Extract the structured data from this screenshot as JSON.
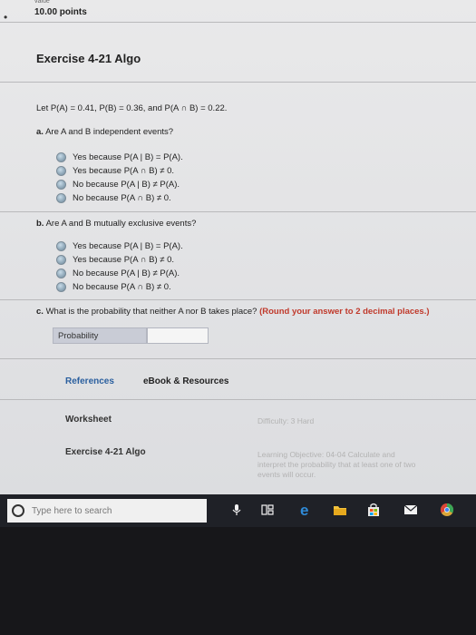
{
  "header": {
    "top_label": "value",
    "points": "10.00 points"
  },
  "exercise": {
    "title": "Exercise 4-21 Algo",
    "premise": "Let P(A) = 0.41, P(B) = 0.36, and P(A ∩ B) = 0.22."
  },
  "part_a": {
    "question": "Are A and B independent events?",
    "letter": "a.",
    "options": [
      "Yes because P(A | B) = P(A).",
      "Yes because P(A ∩ B) ≠ 0.",
      "No because P(A | B) ≠ P(A).",
      "No because P(A ∩ B) ≠ 0."
    ]
  },
  "part_b": {
    "letter": "b.",
    "question": "Are A and B mutually exclusive events?",
    "options": [
      "Yes because P(A | B) = P(A).",
      "Yes because P(A ∩ B) ≠ 0.",
      "No because P(A | B) ≠ P(A).",
      "No because P(A ∩ B) ≠ 0."
    ]
  },
  "part_c": {
    "letter": "c.",
    "question": "What is the probability that neither A nor B takes place?",
    "instruction": "(Round your answer to 2 decimal places.)",
    "field_label": "Probability",
    "field_value": ""
  },
  "links": {
    "references": "References",
    "ebook": "eBook & Resources"
  },
  "meta": {
    "worksheet": "Worksheet",
    "difficulty": "Difficulty: 3 Hard",
    "exercise_ref": "Exercise 4-21 Algo",
    "learning_objective_1": "Learning Objective: 04-04 Calculate and",
    "learning_objective_2": "interpret the probability that at least one of two",
    "learning_objective_3": "events will occur."
  },
  "taskbar": {
    "search_placeholder": "Type here to search",
    "icons": [
      "microphone-icon",
      "task-view-icon",
      "edge-icon",
      "file-explorer-icon",
      "store-icon",
      "mail-icon",
      "chrome-icon"
    ],
    "colors": {
      "edge": "#2f8bd8",
      "explorer": "#f3c33c",
      "store": "#e9e9e9",
      "chrome": "#d9a63a"
    }
  }
}
